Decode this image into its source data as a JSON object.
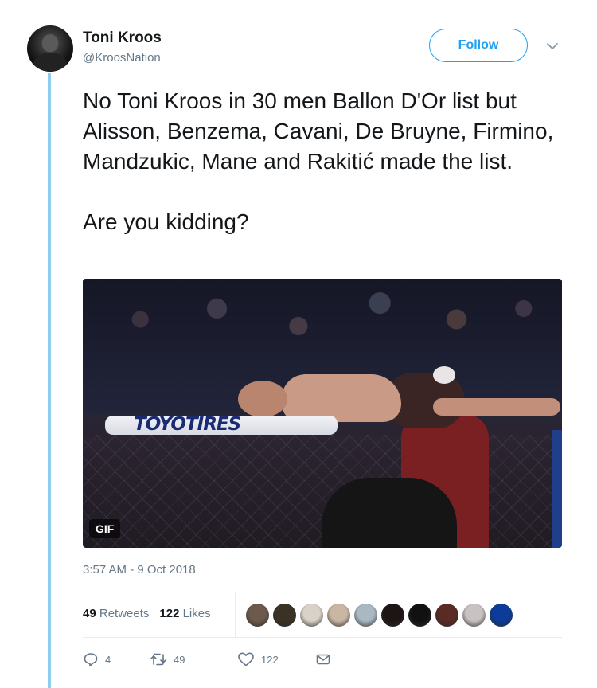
{
  "user": {
    "name": "Toni Kroos",
    "handle": "@KroosNation"
  },
  "header": {
    "follow_label": "Follow",
    "caret_icon": "chevron-down-icon"
  },
  "tweet": {
    "paragraphs": [
      "No Toni Kroos in 30 men Ballon D'Or list but Alisson, Benzema, Cavani, De Bruyne, Firmino, Mandzukic, Mane and Rakitić made the list.",
      "Are you kidding?"
    ]
  },
  "media": {
    "badge": "GIF",
    "sign_text": "TOYOTIRES"
  },
  "meta": {
    "timestamp": "3:57 AM - 9 Oct 2018"
  },
  "stats": {
    "retweets_count": "49",
    "retweets_label": "Retweets",
    "likes_count": "122",
    "likes_label": "Likes"
  },
  "likers": [
    {
      "color": "#6d5a4d"
    },
    {
      "color": "#3b3226"
    },
    {
      "color": "#d9d2c8"
    },
    {
      "color": "#c9b6a3"
    },
    {
      "color": "#aab8c2"
    },
    {
      "color": "#1d1414"
    },
    {
      "color": "#111111"
    },
    {
      "color": "#5a2a24"
    },
    {
      "color": "#c9c2c2"
    },
    {
      "color": "#0b3c9a"
    }
  ],
  "actions": {
    "reply_count": "4",
    "retweet_count": "49",
    "like_count": "122",
    "icons": [
      "reply-icon",
      "retweet-icon",
      "like-icon",
      "message-icon"
    ]
  },
  "colors": {
    "accent": "#1da1f2",
    "thread_line": "#8ecdf2",
    "muted": "#657786",
    "text": "#14171a"
  }
}
